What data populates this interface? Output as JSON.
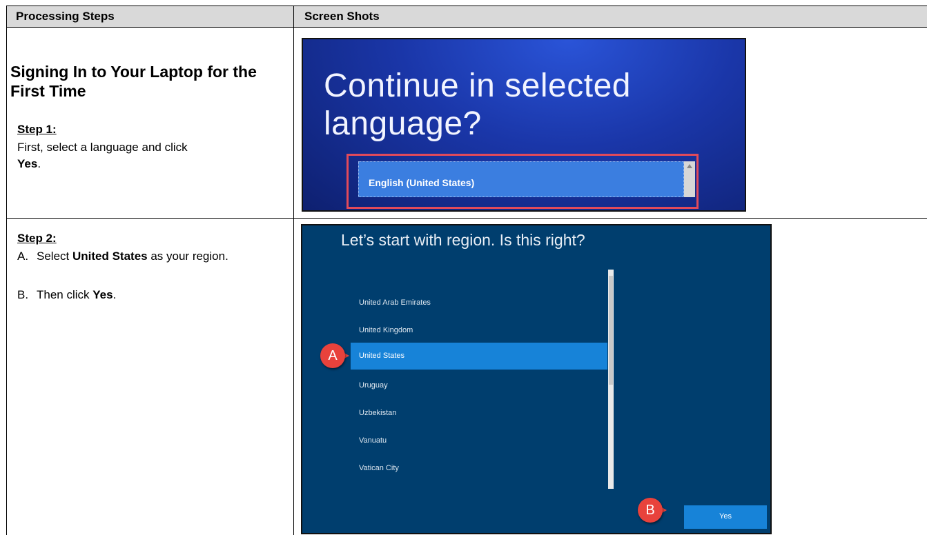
{
  "table": {
    "col1_header": "Processing Steps",
    "col2_header": "Screen Shots"
  },
  "row1": {
    "heading": "Signing In to Your Laptop for the First Time",
    "step_label": "Step 1:",
    "text_before": "First, select a language and click ",
    "bold": "Yes",
    "text_after": "."
  },
  "row2": {
    "step_label": "Step 2:",
    "item_a": {
      "marker": "A.",
      "pre": "Select ",
      "bold": "United States",
      "post": " as your region."
    },
    "item_b": {
      "marker": "B.",
      "pre": "Then click ",
      "bold": "Yes",
      "post": "."
    }
  },
  "shot1": {
    "title": "Continue in selected language?",
    "selected_language": "English (United States)"
  },
  "shot2": {
    "title": "Let’s start with region. Is this right?",
    "regions": [
      "United Arab Emirates",
      "United Kingdom",
      "United States",
      "Uruguay",
      "Uzbekistan",
      "Vanuatu",
      "Vatican City"
    ],
    "selected_region": "United States",
    "yes_label": "Yes",
    "callout_a": "A",
    "callout_b": "B"
  },
  "colors": {
    "header_bg": "#d9d9d9",
    "win_blue": "#003e6e",
    "selection": "#1783d8",
    "callout": "#e8423c",
    "highlight_box": "#e24a5a"
  }
}
